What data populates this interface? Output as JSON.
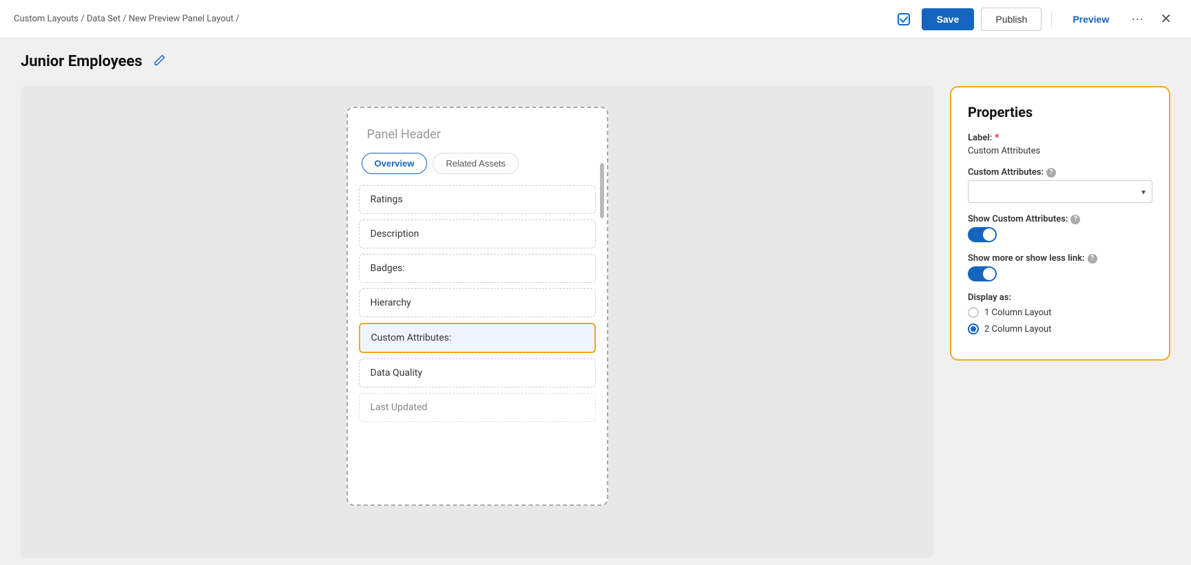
{
  "header": {
    "breadcrumb": "Custom Layouts / Data Set / New Preview Panel Layout /",
    "save_label": "Save",
    "publish_label": "Publish",
    "preview_label": "Preview"
  },
  "page": {
    "title": "Junior Employees",
    "edit_icon": "✏"
  },
  "panel": {
    "header_text": "Panel Header",
    "tabs": [
      {
        "label": "Overview",
        "active": true
      },
      {
        "label": "Related Assets",
        "active": false
      }
    ],
    "items": [
      {
        "label": "Ratings",
        "selected": false
      },
      {
        "label": "Description",
        "selected": false
      },
      {
        "label": "Badges:",
        "selected": false
      },
      {
        "label": "Hierarchy",
        "selected": false
      },
      {
        "label": "Custom Attributes:",
        "selected": true
      },
      {
        "label": "Data Quality",
        "selected": false
      },
      {
        "label": "Last Updated",
        "selected": false,
        "partial": true
      }
    ]
  },
  "properties": {
    "title": "Properties",
    "label_field_label": "Label:",
    "label_field_value": "Custom Attributes",
    "custom_attr_label": "Custom Attributes:",
    "custom_attr_placeholder": "",
    "show_custom_attr_label": "Show Custom Attributes:",
    "show_more_label": "Show more or show less link:",
    "display_as_label": "Display as:",
    "display_options": [
      {
        "label": "1 Column Layout",
        "selected": false
      },
      {
        "label": "2 Column Layout",
        "selected": true
      }
    ]
  },
  "icons": {
    "check": "✓",
    "edit": "✏",
    "chevron_down": "▾",
    "close": "✕",
    "more": "···",
    "help": "?"
  }
}
